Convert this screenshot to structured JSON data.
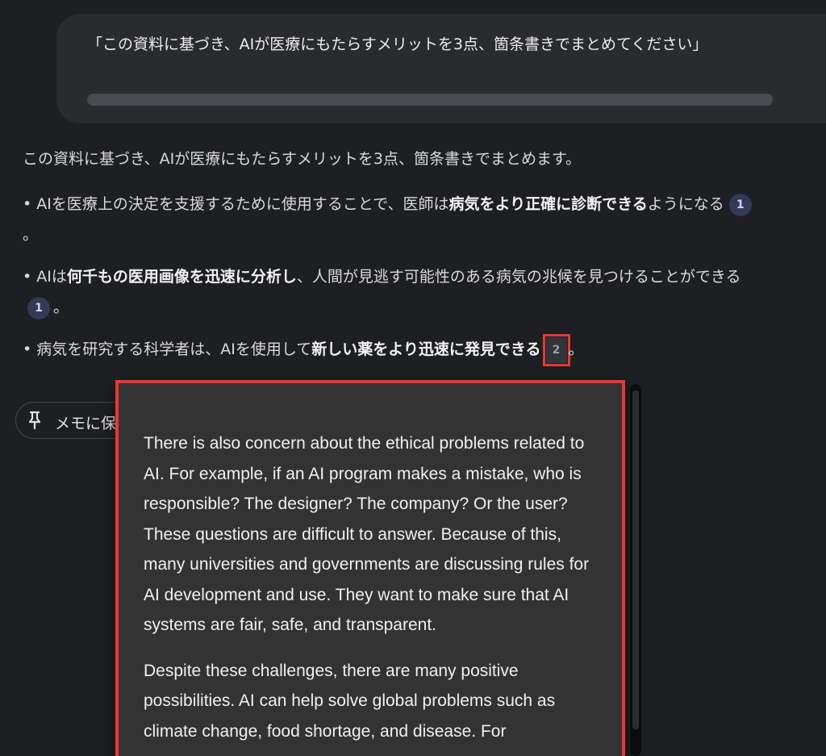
{
  "prompt": {
    "text": "「この資料に基づき、AIが医療にもたらすメリットを3点、箇条書きでまとめてください」"
  },
  "answer": {
    "intro": "この資料に基づき、AIが医療にもたらすメリットを3点、箇条書きでまとめます。",
    "bullets": [
      {
        "bullet": "• ",
        "pre": "AIを医療上の決定を支援するために使用することで、医師は",
        "bold": "病気をより正確に診断できる",
        "post": "ようになる",
        "citation": "1",
        "end": "。"
      },
      {
        "bullet": "• ",
        "pre": "AIは",
        "bold": "何千もの医用画像を迅速に分析し",
        "post": "、人間が見逃す可能性のある病気の兆候を見つけることができる",
        "citation": "1",
        "end": "。"
      },
      {
        "bullet": "• ",
        "pre": "病気を研究する科学者は、AIを使用して",
        "bold": "新しい薬をより迅速に発見できる",
        "post": "",
        "citation": "2",
        "end": "。"
      }
    ]
  },
  "memo": {
    "label": "メモに保"
  },
  "popup": {
    "paragraphs": [
      "There is also concern about the ethical problems related to AI. For example, if an AI program makes a mistake, who is responsible? The designer? The company? Or the user? These questions are difficult to answer. Because of this, many universities and governments are discussing rules for AI development and use. They want to make sure that AI systems are fair, safe, and transparent.",
      "Despite these challenges, there are many positive possibilities. AI can help solve global problems such as climate change, food shortage, and disease. For"
    ]
  },
  "colors": {
    "background": "#1e1f22",
    "highlight": "#e53935",
    "citation": "#353857"
  },
  "icons": {
    "pin": "pin-icon"
  }
}
